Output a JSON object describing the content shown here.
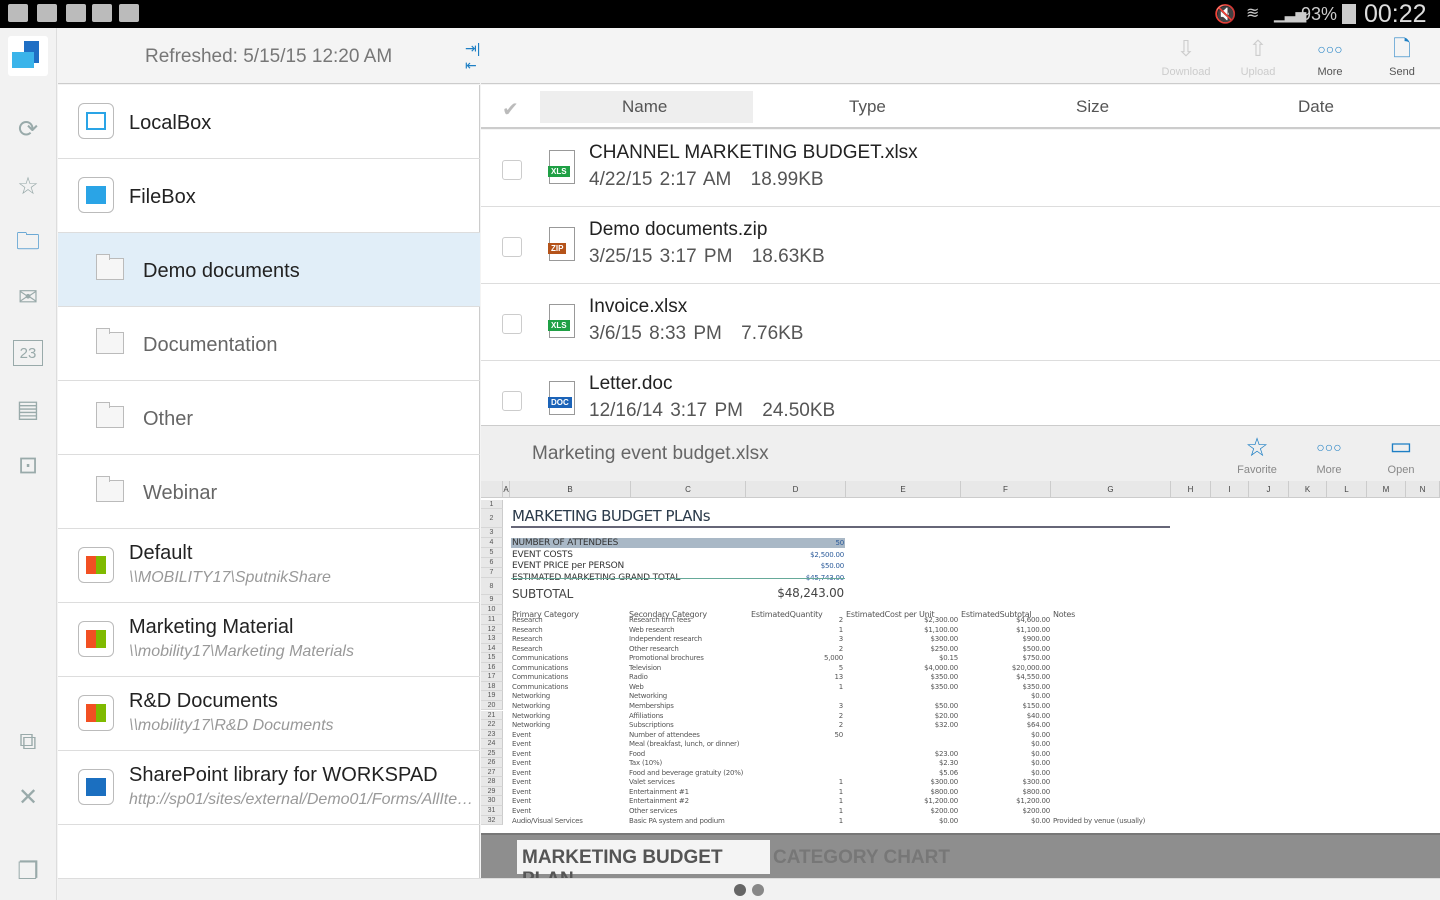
{
  "status_bar": {
    "battery": "93%",
    "time": "00:22"
  },
  "left_header": {
    "refreshed": "Refreshed: 5/15/15 12:20 AM"
  },
  "rail_icons": [
    "app-logo-icon",
    "sync-icon",
    "star-icon",
    "folder-icon",
    "mail-icon",
    "calendar-icon",
    "contacts-icon",
    "presentation-icon",
    "devices-icon",
    "tools-icon",
    "windows-icon"
  ],
  "calendar_day": "23",
  "sources": [
    {
      "title": "LocalBox",
      "icon": "localbox-icon"
    },
    {
      "title": "FileBox",
      "icon": "filebox-icon"
    },
    {
      "title": "Demo documents",
      "icon": "folder-icon",
      "selected": true
    },
    {
      "title": "Documentation",
      "icon": "folder-icon"
    },
    {
      "title": "Other",
      "icon": "folder-icon"
    },
    {
      "title": "Webinar",
      "icon": "folder-icon"
    },
    {
      "title": "Default",
      "subtitle": "\\\\MOBILITY17\\SputnikShare",
      "icon": "windows-share-icon"
    },
    {
      "title": "Marketing Material",
      "subtitle": "\\\\mobility17\\Marketing Materials",
      "icon": "windows-share-icon"
    },
    {
      "title": "R&D Documents",
      "subtitle": "\\\\mobility17\\R&D Documents",
      "icon": "windows-share-icon"
    },
    {
      "title": "SharePoint library for WORKSPAD",
      "subtitle": "http://sp01/sites/external/Demo01/Forms/AllItems.aspx",
      "icon": "sharepoint-icon"
    }
  ],
  "toolbar": {
    "download": "Download",
    "upload": "Upload",
    "more": "More",
    "send": "Send"
  },
  "columns": {
    "name": "Name",
    "type": "Type",
    "size": "Size",
    "date": "Date"
  },
  "files": [
    {
      "name": "CHANNEL MARKETING BUDGET.xlsx",
      "date": "4/22/15 2:17 AM",
      "size": "18.99KB",
      "badge": "XLS",
      "badge_color": "#1fa045"
    },
    {
      "name": "Demo documents.zip",
      "date": "3/25/15 3:17 PM",
      "size": "18.63KB",
      "badge": "ZIP",
      "badge_color": "#b5531a"
    },
    {
      "name": "Invoice.xlsx",
      "date": "3/6/15 8:33 PM",
      "size": "7.76KB",
      "badge": "XLS",
      "badge_color": "#1fa045"
    },
    {
      "name": "Letter.doc",
      "date": "12/16/14 3:17 PM",
      "size": "24.50KB",
      "badge": "DOC",
      "badge_color": "#1b63b8"
    }
  ],
  "preview": {
    "title": "Marketing event budget.xlsx",
    "favorite": "Favorite",
    "more": "More",
    "open": "Open"
  },
  "sheet": {
    "col_letters": [
      "A",
      "B",
      "C",
      "D",
      "E",
      "F",
      "G",
      "H",
      "I",
      "J",
      "K",
      "L",
      "M",
      "N"
    ],
    "title": "MARKETING BUDGET PLANs",
    "summary": [
      {
        "label": "NUMBER OF ATTENDEES",
        "value": "50"
      },
      {
        "label": "EVENT COSTS",
        "value": "$2,500.00"
      },
      {
        "label": "EVENT PRICE per PERSON",
        "value": "$50.00"
      },
      {
        "label": "ESTIMATED MARKETING GRAND TOTAL",
        "value": "$45,743.00"
      }
    ],
    "subtotal_label": "SUBTOTAL",
    "subtotal_value": "$48,243.00",
    "headers": [
      "Primary Category",
      "Secondary Category",
      "EstimatedQuantity",
      "EstimatedCost per Unit",
      "EstimatedSubtotal",
      "Notes"
    ],
    "rows": [
      [
        "Research",
        "Research firm fees",
        "2",
        "$2,300.00",
        "$4,600.00",
        ""
      ],
      [
        "Research",
        "Web research",
        "1",
        "$1,100.00",
        "$1,100.00",
        ""
      ],
      [
        "Research",
        "Independent research",
        "3",
        "$300.00",
        "$900.00",
        ""
      ],
      [
        "Research",
        "Other research",
        "2",
        "$250.00",
        "$500.00",
        ""
      ],
      [
        "Communications",
        "Promotional brochures",
        "5,000",
        "$0.15",
        "$750.00",
        ""
      ],
      [
        "Communications",
        "Television",
        "5",
        "$4,000.00",
        "$20,000.00",
        ""
      ],
      [
        "Communications",
        "Radio",
        "13",
        "$350.00",
        "$4,550.00",
        ""
      ],
      [
        "Communications",
        "Web",
        "1",
        "$350.00",
        "$350.00",
        ""
      ],
      [
        "Networking",
        "Networking",
        "",
        "",
        "$0.00",
        ""
      ],
      [
        "Networking",
        "Memberships",
        "3",
        "$50.00",
        "$150.00",
        ""
      ],
      [
        "Networking",
        "Affiliations",
        "2",
        "$20.00",
        "$40.00",
        ""
      ],
      [
        "Networking",
        "Subscriptions",
        "2",
        "$32.00",
        "$64.00",
        ""
      ],
      [
        "Event",
        "Number of attendees",
        "50",
        "",
        "$0.00",
        ""
      ],
      [
        "Event",
        "Meal (breakfast, lunch, or dinner)",
        "",
        "",
        "$0.00",
        ""
      ],
      [
        "Event",
        "Food",
        "",
        "$23.00",
        "$0.00",
        ""
      ],
      [
        "Event",
        "Tax (10%)",
        "",
        "$2.30",
        "$0.00",
        ""
      ],
      [
        "Event",
        "Food and beverage gratuity (20%)",
        "",
        "$5.06",
        "$0.00",
        ""
      ],
      [
        "Event",
        "Valet services",
        "1",
        "$300.00",
        "$300.00",
        ""
      ],
      [
        "Event",
        "Entertainment #1",
        "1",
        "$800.00",
        "$800.00",
        ""
      ],
      [
        "Event",
        "Entertainment #2",
        "1",
        "$1,200.00",
        "$1,200.00",
        ""
      ],
      [
        "Event",
        "Other services",
        "1",
        "$200.00",
        "$200.00",
        ""
      ],
      [
        "Audio/Visual Services",
        "Basic PA system and podium",
        "1",
        "$0.00",
        "$0.00",
        "Provided by venue (usually)"
      ]
    ],
    "tabs": [
      {
        "label": "MARKETING BUDGET PLAN",
        "active": true
      },
      {
        "label": "CATEGORY CHART",
        "active": false
      }
    ]
  },
  "pager": {
    "pages": 2,
    "current": 1
  },
  "colors": {
    "accent": "#1e7fc4",
    "selected_row": "#e1eef8",
    "summary_band": "#a9b8c6"
  }
}
